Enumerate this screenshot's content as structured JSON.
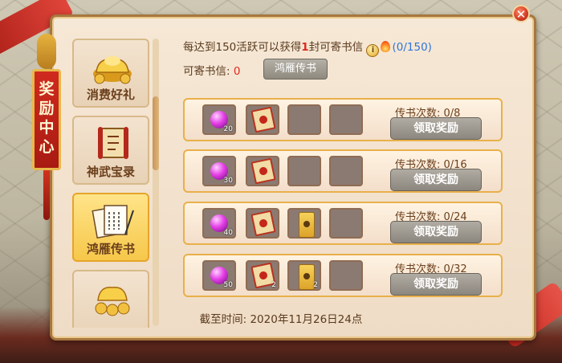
{
  "window": {
    "close_glyph": "✕",
    "side_tag": "奖励中心"
  },
  "sidebar": {
    "items": [
      {
        "label": "消费好礼",
        "icon": "gold-ingot-icon"
      },
      {
        "label": "神武宝录",
        "icon": "scroll-book-icon"
      },
      {
        "label": "鸿雁传书",
        "icon": "letter-quill-icon",
        "active": true
      },
      {
        "label": "",
        "icon": "gold-ingot-coins-icon"
      }
    ]
  },
  "info": {
    "text_prefix": "每达到150活跃可以获得",
    "number": "1",
    "text_suffix": "封可寄书信",
    "info_glyph": "i",
    "progress": "(0/150)",
    "letters_label": "可寄书信:",
    "letters_value": "0",
    "tab_label": "鸿雁传书"
  },
  "rows": [
    {
      "count_label": "传书次数: 0/8",
      "button": "领取奖励",
      "slots": [
        {
          "icon": "purple-gem-icon",
          "count": "20"
        },
        {
          "icon": "red-letter-icon",
          "count": ""
        },
        {
          "icon": "",
          "count": ""
        },
        {
          "icon": "",
          "count": ""
        }
      ]
    },
    {
      "count_label": "传书次数: 0/16",
      "button": "领取奖励",
      "slots": [
        {
          "icon": "purple-gem-icon",
          "count": "30"
        },
        {
          "icon": "red-letter-icon",
          "count": ""
        },
        {
          "icon": "",
          "count": ""
        },
        {
          "icon": "",
          "count": ""
        }
      ]
    },
    {
      "count_label": "传书次数: 0/24",
      "button": "领取奖励",
      "slots": [
        {
          "icon": "purple-gem-icon",
          "count": "40"
        },
        {
          "icon": "red-letter-icon",
          "count": ""
        },
        {
          "icon": "gold-scroll-icon",
          "count": ""
        },
        {
          "icon": "",
          "count": ""
        }
      ]
    },
    {
      "count_label": "传书次数: 0/32",
      "button": "领取奖励",
      "slots": [
        {
          "icon": "purple-gem-icon",
          "count": "50"
        },
        {
          "icon": "red-letter-icon",
          "count": "2"
        },
        {
          "icon": "gold-scroll-icon",
          "count": "2"
        },
        {
          "icon": "",
          "count": ""
        }
      ]
    }
  ],
  "deadline": "截至时间: 2020年11月26日24点",
  "colors": {
    "accent_red": "#e0281c",
    "progress_blue": "#2f74d8",
    "frame_gold": "#e9b04a"
  }
}
